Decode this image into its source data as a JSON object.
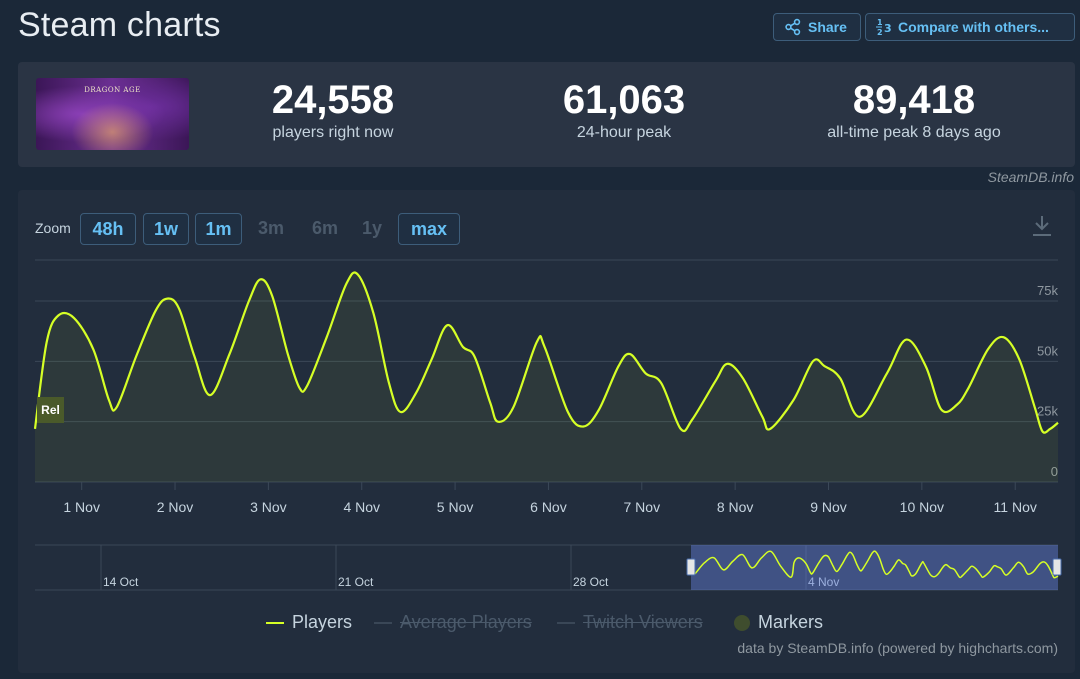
{
  "title": "Steam charts",
  "header": {
    "share_label": "Share",
    "compare_label": "Compare with others...",
    "accent": "#66c0f4"
  },
  "game": {
    "thumb_text": "DRAGON AGE"
  },
  "stats": [
    {
      "value": "24,558",
      "label": "players right now"
    },
    {
      "value": "61,063",
      "label": "24-hour peak"
    },
    {
      "value": "89,418",
      "label": "all-time peak 8 days ago"
    }
  ],
  "credit_top": "SteamDB.info",
  "zoom": {
    "label": "Zoom",
    "buttons": [
      {
        "label": "48h",
        "state": "active"
      },
      {
        "label": "1w",
        "state": "active"
      },
      {
        "label": "1m",
        "state": "active"
      },
      {
        "label": "3m",
        "state": "disabled"
      },
      {
        "label": "6m",
        "state": "disabled"
      },
      {
        "label": "1y",
        "state": "disabled"
      },
      {
        "label": "max",
        "state": "active"
      }
    ]
  },
  "chart_data": {
    "type": "line",
    "title": "",
    "xlabel": "",
    "ylabel": "",
    "ylim": [
      0,
      92000
    ],
    "yticks": [
      0,
      25000,
      50000,
      75000
    ],
    "ytick_labels": [
      "0",
      "25k",
      "50k",
      "75k"
    ],
    "x_start": "2024-10-31T12:00",
    "x_end": "2024-11-11T11:00",
    "x_ticks": [
      "1 Nov",
      "2 Nov",
      "3 Nov",
      "4 Nov",
      "5 Nov",
      "6 Nov",
      "7 Nov",
      "8 Nov",
      "9 Nov",
      "10 Nov",
      "11 Nov"
    ],
    "color": "#d6ff26",
    "series": [
      {
        "name": "Players",
        "points": [
          [
            "2024-10-31T12:00",
            22000
          ],
          [
            "2024-10-31T15:00",
            58000
          ],
          [
            "2024-10-31T18:00",
            69000
          ],
          [
            "2024-10-31T22:00",
            68000
          ],
          [
            "2024-11-01T03:00",
            55000
          ],
          [
            "2024-11-01T07:00",
            34000
          ],
          [
            "2024-11-01T09:00",
            31000
          ],
          [
            "2024-11-01T14:00",
            52000
          ],
          [
            "2024-11-01T19:00",
            71000
          ],
          [
            "2024-11-01T22:00",
            76000
          ],
          [
            "2024-11-02T01:00",
            72000
          ],
          [
            "2024-11-02T05:00",
            52000
          ],
          [
            "2024-11-02T09:00",
            36000
          ],
          [
            "2024-11-02T14:00",
            53000
          ],
          [
            "2024-11-02T19:00",
            75000
          ],
          [
            "2024-11-02T22:00",
            84000
          ],
          [
            "2024-11-03T01:00",
            77000
          ],
          [
            "2024-11-03T05:00",
            53000
          ],
          [
            "2024-11-03T08:00",
            39000
          ],
          [
            "2024-11-03T10:00",
            40000
          ],
          [
            "2024-11-03T15:00",
            60000
          ],
          [
            "2024-11-03T20:00",
            82000
          ],
          [
            "2024-11-03T23:00",
            86000
          ],
          [
            "2024-11-04T03:00",
            70000
          ],
          [
            "2024-11-04T07:00",
            41000
          ],
          [
            "2024-11-04T10:00",
            29000
          ],
          [
            "2024-11-04T14:00",
            37000
          ],
          [
            "2024-11-04T18:00",
            51000
          ],
          [
            "2024-11-04T22:00",
            65000
          ],
          [
            "2024-11-05T02:00",
            56000
          ],
          [
            "2024-11-05T05:00",
            52000
          ],
          [
            "2024-11-05T09:00",
            33000
          ],
          [
            "2024-11-05T11:00",
            25000
          ],
          [
            "2024-11-05T15:00",
            31000
          ],
          [
            "2024-11-05T21:00",
            58000
          ],
          [
            "2024-11-05T23:00",
            56000
          ],
          [
            "2024-11-06T05:00",
            29000
          ],
          [
            "2024-11-06T09:00",
            23000
          ],
          [
            "2024-11-06T13:00",
            30000
          ],
          [
            "2024-11-06T18:00",
            48000
          ],
          [
            "2024-11-06T21:00",
            53000
          ],
          [
            "2024-11-07T01:00",
            45000
          ],
          [
            "2024-11-07T05:00",
            41000
          ],
          [
            "2024-11-07T10:00",
            22000
          ],
          [
            "2024-11-07T13:00",
            26000
          ],
          [
            "2024-11-07T19:00",
            42000
          ],
          [
            "2024-11-07T22:00",
            49000
          ],
          [
            "2024-11-08T02:00",
            43000
          ],
          [
            "2024-11-08T07:00",
            27000
          ],
          [
            "2024-11-08T09:00",
            22000
          ],
          [
            "2024-11-08T15:00",
            34000
          ],
          [
            "2024-11-08T20:00",
            50000
          ],
          [
            "2024-11-08T23:00",
            48000
          ],
          [
            "2024-11-09T03:00",
            43000
          ],
          [
            "2024-11-09T08:00",
            27000
          ],
          [
            "2024-11-09T15:00",
            45000
          ],
          [
            "2024-11-09T20:00",
            59000
          ],
          [
            "2024-11-10T01:00",
            48000
          ],
          [
            "2024-11-10T05:00",
            30000
          ],
          [
            "2024-11-10T09:00",
            32000
          ],
          [
            "2024-11-10T12:00",
            39000
          ],
          [
            "2024-11-10T17:00",
            55000
          ],
          [
            "2024-11-10T21:00",
            60000
          ],
          [
            "2024-11-11T01:00",
            51000
          ],
          [
            "2024-11-11T05:00",
            31000
          ],
          [
            "2024-11-11T07:00",
            21000
          ],
          [
            "2024-11-11T09:00",
            22000
          ],
          [
            "2024-11-11T11:00",
            24558
          ]
        ]
      }
    ],
    "marker_flag": "Rel",
    "navigator": {
      "labels": [
        "14 Oct",
        "21 Oct",
        "28 Oct",
        "4 Nov"
      ]
    },
    "legend": [
      {
        "name": "Players",
        "visible": true
      },
      {
        "name": "Average Players",
        "visible": false
      },
      {
        "name": "Twitch Viewers",
        "visible": false
      },
      {
        "name": "Markers",
        "visible": true
      }
    ]
  },
  "credit_bottom": "data by SteamDB.info (powered by highcharts.com)"
}
